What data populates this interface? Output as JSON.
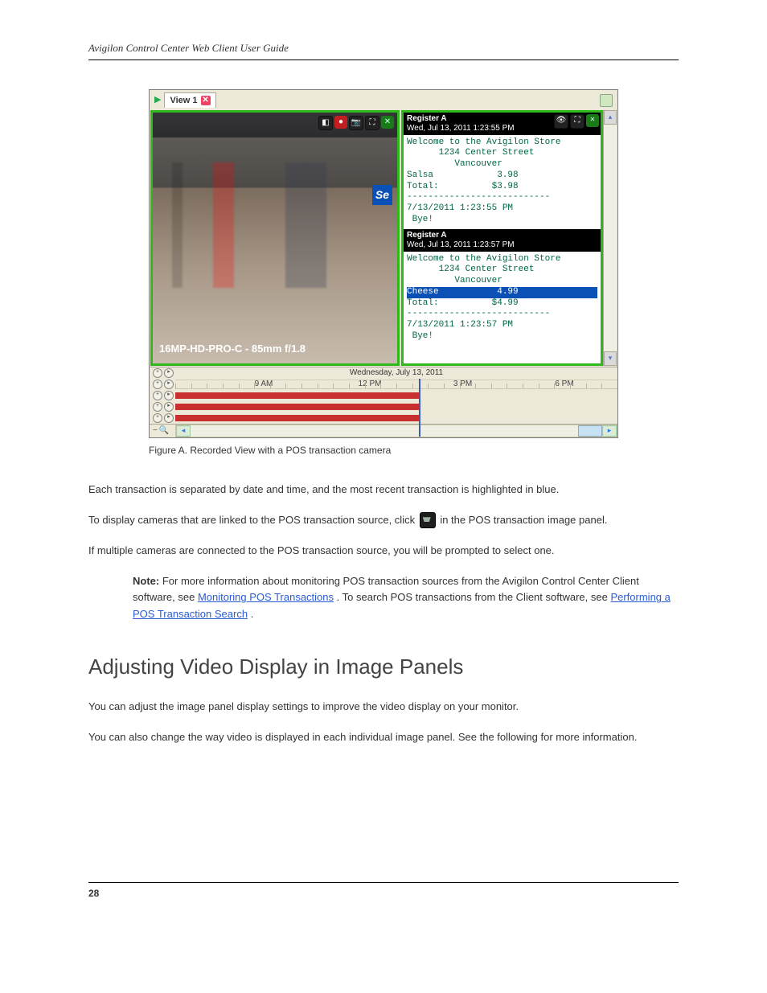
{
  "doc": {
    "header_title": "Avigilon Control Center Web Client User Guide",
    "page_number": "28",
    "section_heading": "Adjusting Video Display in Image Panels"
  },
  "figure": {
    "tab_label": "View 1",
    "camera_label": "16MP-HD-PRO-C - 85mm f/1.8",
    "tabbar_right_icon": "layout-menu-icon",
    "left_icons": [
      "snapshot-icon",
      "record-icon",
      "camera-icon",
      "fullscreen-icon",
      "close-icon"
    ],
    "caption": "Figure A. Recorded View with a POS transaction camera"
  },
  "receipt1": {
    "title": "Register A",
    "timestamp_header": "Wed, Jul 13, 2011 1:23:55 PM",
    "welcome": "Welcome to the Avigilon Store",
    "addr1": "1234 Center Street",
    "addr2": "Vancouver",
    "item_name": "Salsa",
    "item_price": "3.98",
    "total_label": "Total:",
    "total_value": "$3.98",
    "sep": "---------------------------",
    "ts_line": "7/13/2011 1:23:55 PM",
    "bye": "Bye!",
    "right_icons": [
      "pos-source-icon",
      "fullscreen-icon",
      "close-icon"
    ]
  },
  "receipt2": {
    "title": "Register A",
    "timestamp_header": "Wed, Jul 13, 2011 1:23:57 PM",
    "welcome": "Welcome to the Avigilon Store",
    "addr1": "1234 Center Street",
    "addr2": "Vancouver",
    "item_name": "Cheese",
    "item_price": "4.99",
    "total_label": "Total:",
    "total_value": "$4.99",
    "sep": "---------------------------",
    "ts_line": "7/13/2011 1:23:57 PM",
    "bye": "Bye!"
  },
  "timeline": {
    "date": "Wednesday, July 13, 2011",
    "labels": [
      "9 AM",
      "12 PM",
      "3 PM",
      "6 PM"
    ],
    "label_positions": [
      "20%",
      "44%",
      "65%",
      "88%"
    ]
  },
  "body": {
    "p1": "Each transaction is separated by date and time, and the most recent transaction is highlighted in blue.",
    "p2_a": "To display cameras that are linked to the POS transaction source, click ",
    "p2_b": " in the POS transaction image panel.",
    "p3": "If multiple cameras are connected to the POS transaction source, you will be prompted to select one.",
    "note_label": "Note:",
    "note_1a": "For more information about monitoring POS transaction sources from the Avigilon Control Center Client software, see ",
    "note_1a_link": "Monitoring POS Transactions",
    "note_1b": ". To search POS transactions from the Client software, see ",
    "note_1b_link": "Performing a POS Transaction Search",
    "note_1c": ".",
    "p_adjust_a": "You can adjust the image panel display settings to improve the video display on your monitor.",
    "p_adjust_b": "You can also change the way video is displayed in each individual image panel. See the following for more information."
  }
}
